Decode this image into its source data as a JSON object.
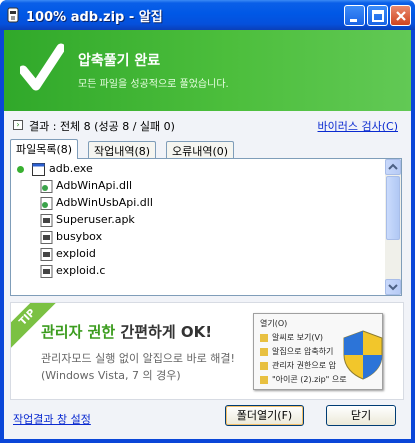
{
  "window": {
    "title": "100% adb.zip - 알집"
  },
  "header": {
    "title": "압축풀기 완료",
    "subtitle": "모든 파일을 성공적으로 풀었습니다."
  },
  "result": {
    "summary": "결과 : 전체 8 (성공 8 / 실패 0)",
    "virus_check": "바이러스 검사(C)"
  },
  "tabs": [
    {
      "label": "파일목록(8)",
      "active": true
    },
    {
      "label": "작업내역(8)",
      "active": false
    },
    {
      "label": "오류내역(0)",
      "active": false
    }
  ],
  "files": [
    {
      "name": "adb.exe",
      "icon": "exe-icon"
    },
    {
      "name": "AdbWinApi.dll",
      "icon": "dll-icon"
    },
    {
      "name": "AdbWinUsbApi.dll",
      "icon": "dll-icon"
    },
    {
      "name": "Superuser.apk",
      "icon": "file-icon"
    },
    {
      "name": "busybox",
      "icon": "file-icon"
    },
    {
      "name": "exploid",
      "icon": "file-icon"
    },
    {
      "name": "exploid.c",
      "icon": "file-icon"
    }
  ],
  "tip": {
    "badge": "TIP",
    "title_highlight": "관리자 권한",
    "title_rest": " 간편하게 OK!",
    "desc1": "관리자모드 실행 없이 알집으로 바로 해결!",
    "desc2": "(Windows Vista, 7 의 경우)",
    "menu_items": [
      "열기(O)",
      "알씨로 보기(V)",
      "알집으로 압축하기",
      "관리자 권한으로 압",
      "\"아이콘 (2).zip\" 으로"
    ]
  },
  "footer": {
    "settings_link": "작업결과 창 설정",
    "open_folder": "폴더열기(F)",
    "close": "닫기"
  },
  "colors": {
    "banner_green": "#4cbe3c",
    "link_blue": "#0a2ad0",
    "title_bar": "#0058e6"
  }
}
